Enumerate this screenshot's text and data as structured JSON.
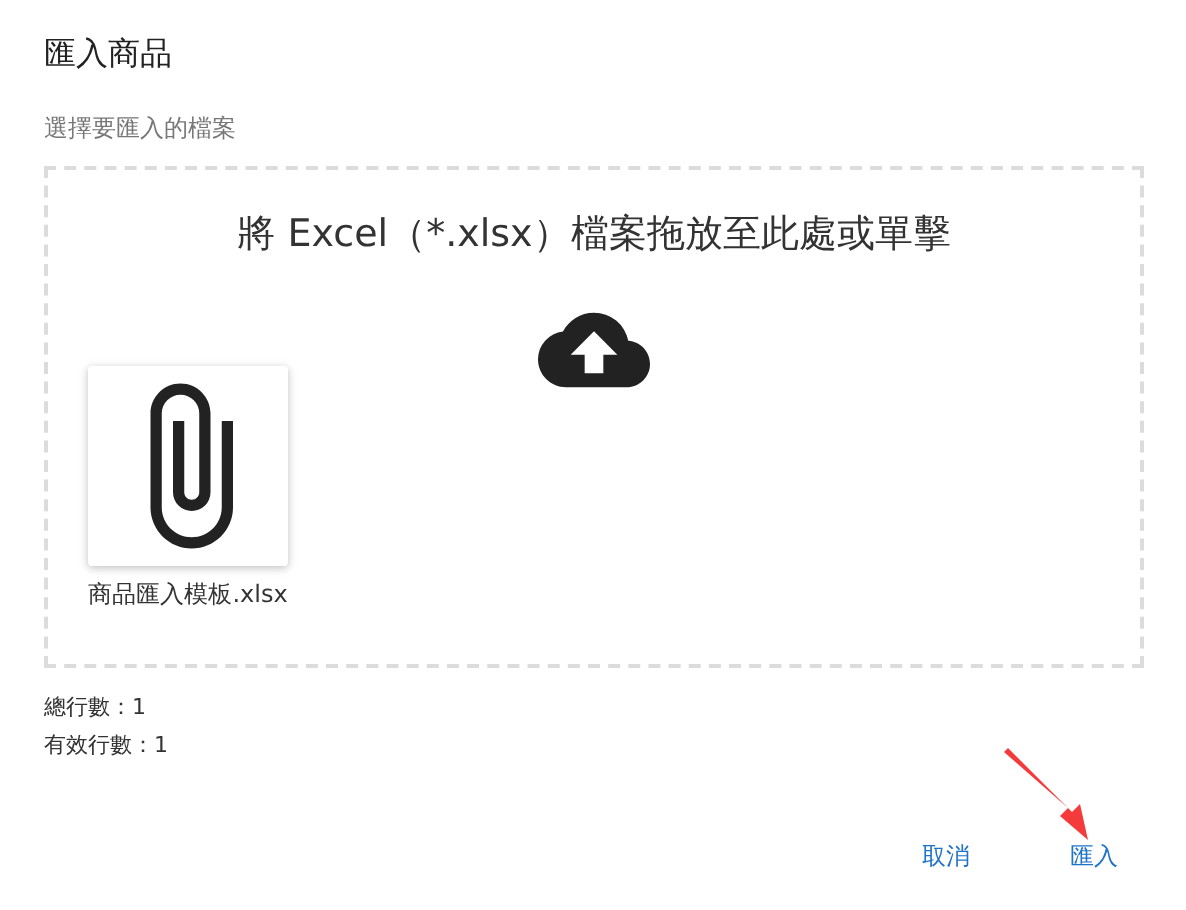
{
  "dialog": {
    "title": "匯入商品"
  },
  "file_picker": {
    "label": "選擇要匯入的檔案",
    "prompt": "將 Excel（*.xlsx）檔案拖放至此處或單擊",
    "files": [
      {
        "name": "商品匯入模板.xlsx"
      }
    ]
  },
  "stats": [
    "總行數：1",
    "有效行數：1"
  ],
  "buttons": [
    {
      "label": "取消"
    },
    {
      "label": "匯入"
    }
  ]
}
